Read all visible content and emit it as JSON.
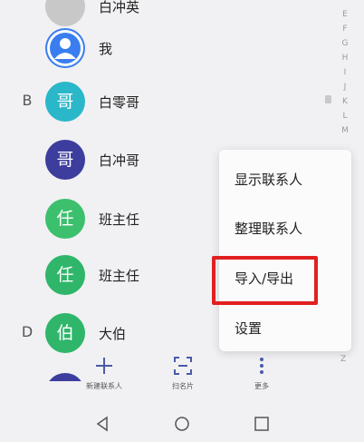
{
  "contacts": [
    {
      "letter": "",
      "avatar_text": "",
      "name": "白冲英",
      "color": "grey"
    },
    {
      "letter": "",
      "avatar_text": "",
      "name": "我",
      "color": "blue-person"
    },
    {
      "letter": "B",
      "avatar_text": "哥",
      "name": "白零哥",
      "color": "teal"
    },
    {
      "letter": "",
      "avatar_text": "哥",
      "name": "白冲哥",
      "color": "indigo"
    },
    {
      "letter": "",
      "avatar_text": "任",
      "name": "班主任",
      "color": "green2"
    },
    {
      "letter": "",
      "avatar_text": "任",
      "name": "班主任",
      "color": "green"
    },
    {
      "letter": "D",
      "avatar_text": "伯",
      "name": "大伯",
      "color": "green"
    }
  ],
  "index_letters": [
    "E",
    "F",
    "G",
    "H",
    "I",
    "J",
    "K",
    "L",
    "M"
  ],
  "index_bottom": "Z",
  "menu": {
    "items": [
      "显示联系人",
      "整理联系人",
      "导入/导出",
      "设置"
    ],
    "highlighted_index": 2
  },
  "toolbar": {
    "new_contact": {
      "label": "新建联系人",
      "icon": "plus-icon"
    },
    "scan_card": {
      "label": "扫名片",
      "icon": "scan-icon"
    },
    "more": {
      "label": "更多",
      "icon": "more-vertical-icon"
    }
  },
  "colors": {
    "highlight": "#e02020",
    "accent": "#4a5aa8"
  }
}
